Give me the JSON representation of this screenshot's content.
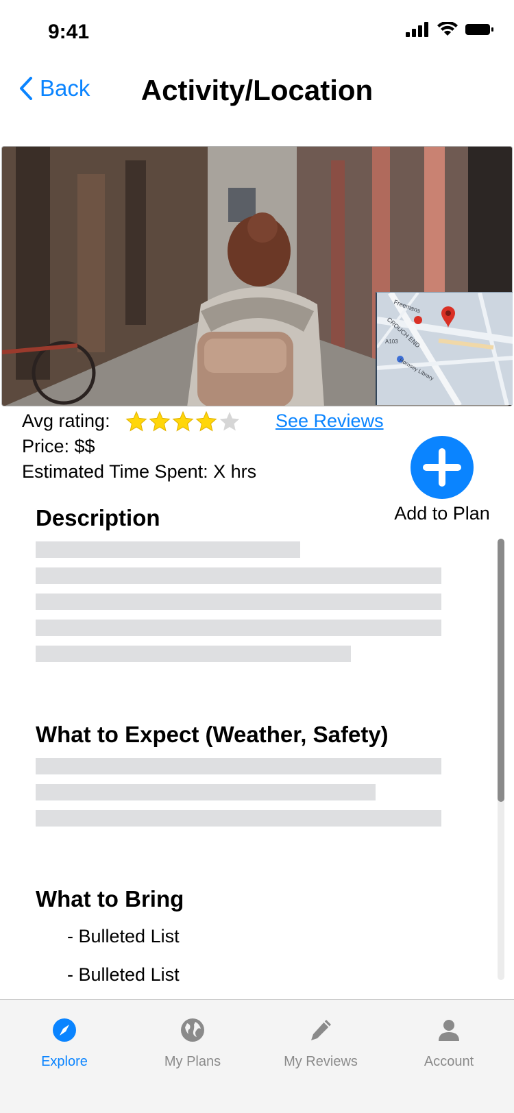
{
  "status_bar": {
    "time": "9:41"
  },
  "nav": {
    "back_label": "Back",
    "title": "Activity/Location"
  },
  "info": {
    "rating_label": "Avg rating:",
    "rating": 4,
    "rating_max": 5,
    "see_reviews": "See Reviews",
    "price": "Price: $$",
    "time_spent": "Estimated Time Spent: X hrs"
  },
  "add_plan": {
    "label": "Add to Plan"
  },
  "sections": {
    "description": "Description",
    "expect": "What to Expect (Weather, Safety)",
    "bring": "What to Bring",
    "bullets": [
      "- Bulleted List",
      "- Bulleted List"
    ]
  },
  "map": {
    "labels": [
      "Freemans",
      "CROUCH END",
      "A103",
      "Hornsey Library"
    ]
  },
  "tabs": [
    {
      "label": "Explore",
      "icon": "compass-icon",
      "active": true
    },
    {
      "label": "My Plans",
      "icon": "globe-icon",
      "active": false
    },
    {
      "label": "My Reviews",
      "icon": "pencil-icon",
      "active": false
    },
    {
      "label": "Account",
      "icon": "person-icon",
      "active": false
    }
  ],
  "colors": {
    "accent": "#0a84ff",
    "star": "#ffd60a",
    "placeholder": "#dedfe1"
  }
}
